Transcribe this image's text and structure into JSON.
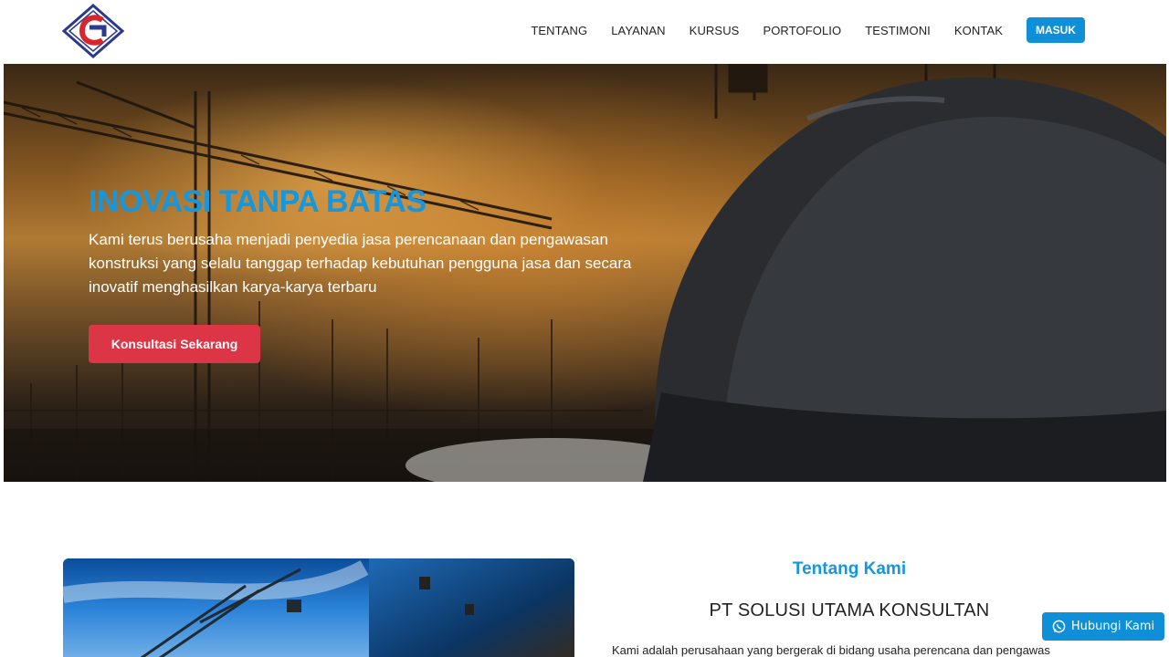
{
  "header": {
    "nav": [
      "TENTANG",
      "LAYANAN",
      "KURSUS",
      "PORTOFOLIO",
      "TESTIMONI",
      "KONTAK"
    ],
    "login_label": "MASUK"
  },
  "hero": {
    "title": "INOVASI TANPA BATAS",
    "text": "Kami terus berusaha menjadi penyedia jasa perencanaan dan pengawasan konstruksi yang selalu tanggap terhadap kebutuhan pengguna jasa dan secara inovatif menghasilkan karya-karya terbaru",
    "cta_label": "Konsultasi Sekarang"
  },
  "about": {
    "label": "Tentang Kami",
    "company": "PT SOLUSI UTAMA KONSULTAN",
    "text": "Kami adalah perusahaan yang bergerak di bidang usaha perencana dan pengawas"
  },
  "whatsapp": {
    "label": "Hubungi Kami",
    "icon": "whatsapp-icon"
  },
  "colors": {
    "accent": "#1597e0",
    "cta": "#dc3545",
    "button": "#0e8fd8"
  }
}
